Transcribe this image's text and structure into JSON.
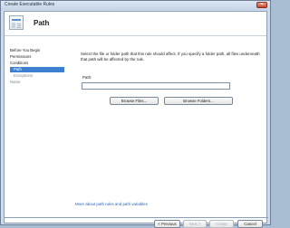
{
  "window": {
    "title": "Create Executable Rules",
    "close_glyph": "✕"
  },
  "header": {
    "title": "Path",
    "icon": "rule-wizard-icon"
  },
  "sidebar": {
    "items": [
      {
        "label": "Before You Begin",
        "state": "normal"
      },
      {
        "label": "Permissions",
        "state": "normal"
      },
      {
        "label": "Conditions",
        "state": "normal"
      },
      {
        "label": "Path",
        "state": "selected"
      },
      {
        "label": "Exceptions",
        "state": "dim"
      },
      {
        "label": "Name",
        "state": "dim"
      }
    ]
  },
  "main": {
    "description": "Select the file or folder path that this rule should affect. If you specify a folder path, all files underneath that path will be affected by the rule.",
    "path_label": "Path:",
    "path_value": "",
    "browse_files_label": "Browse Files...",
    "browse_folders_label": "Browse Folders...",
    "more_link": "More about path rules and path variables"
  },
  "buttons": {
    "previous": "< Previous",
    "next": "Next >",
    "create": "Create",
    "cancel": "Cancel"
  },
  "colors": {
    "selection": "#3c7fd1",
    "link": "#2a64b8",
    "chrome": "#cfdbe9"
  }
}
